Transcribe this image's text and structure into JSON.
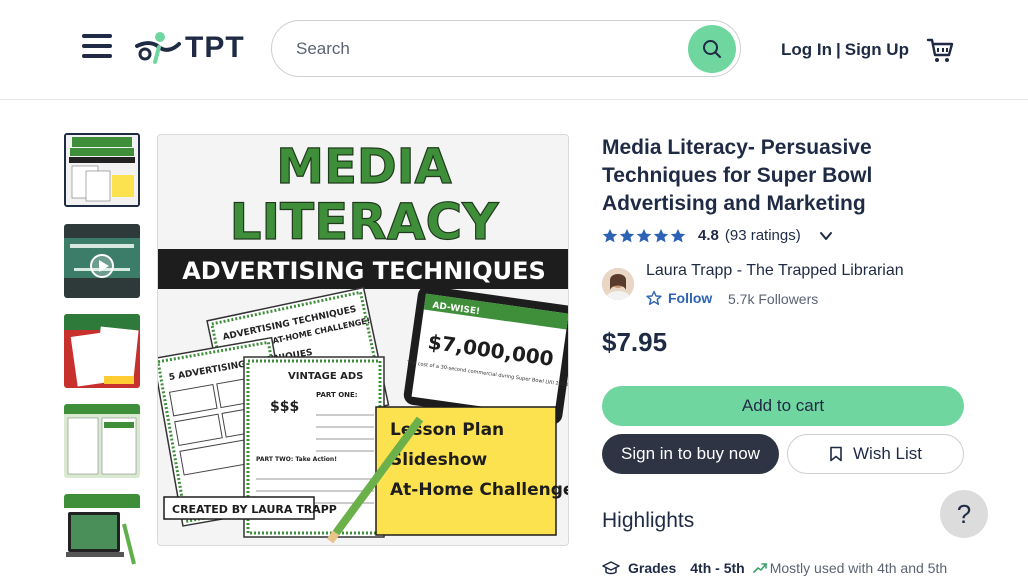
{
  "header": {
    "logo_text": "TPT",
    "search_placeholder": "Search",
    "login_label": "Log In",
    "separator": "|",
    "signup_label": "Sign Up"
  },
  "product": {
    "title": "Media Literacy- Persuasive Techniques for Super Bowl Advertising and Marketing",
    "rating": "4.8",
    "rating_count": "(93 ratings)",
    "star_count": 5,
    "seller_name": "Laura Trapp - The Trapped Librarian",
    "follow_label": "Follow",
    "followers": "5.7k Followers",
    "price": "$7.95",
    "add_to_cart_label": "Add to cart",
    "buy_now_label": "Sign in to buy now",
    "wishlist_label": "Wish List"
  },
  "cover": {
    "line1": "MEDIA",
    "line2": "LITERACY",
    "banner": "ADVERTISING TECHNIQUES",
    "items": [
      "Lesson Plan",
      "Slideshow",
      "At-Home Challenge"
    ],
    "credit": "CREATED BY LAURA TRAPP",
    "tablet_price": "$7,000,000",
    "tablet_heading": "AD-WISE!",
    "tablet_caption": "The cost of a 30-second commercial during Super Bowl LVII 2023",
    "sheet1_title": "ADVERTISING TECHNIQUES",
    "sheet1_sub": "AT-HOME CHALLENGE!",
    "sheet2_title": "5 ADVERTISING TECHNIQUES",
    "sheet3_title": "VINTAGE ADS",
    "sheet3_price": "$$$",
    "part_one": "PART ONE:",
    "part_two": "PART TWO: Take Action!"
  },
  "highlights": {
    "heading": "Highlights",
    "grades_label": "Grades",
    "grades_value": "4th - 5th",
    "grades_note": "Mostly used with 4th and 5th"
  },
  "help_label": "?",
  "colors": {
    "brand_green": "#6fd6a0",
    "cover_green": "#3f8f3a",
    "dark_navy": "#1f2a44",
    "link_blue": "#2d63b5",
    "star_blue": "#2d63b5"
  }
}
